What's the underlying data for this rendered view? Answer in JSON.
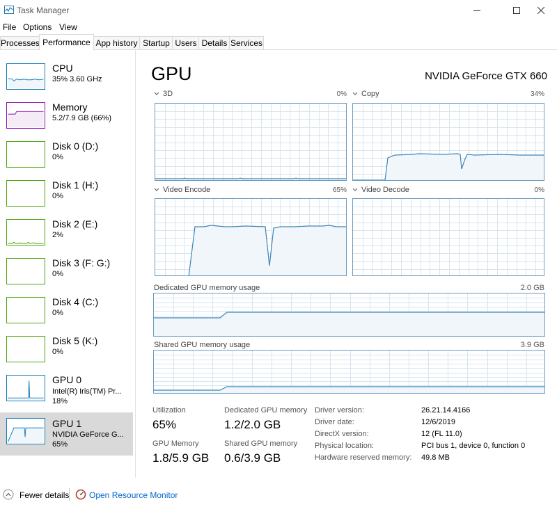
{
  "window": {
    "title": "Task Manager"
  },
  "menu": [
    "File",
    "Options",
    "View"
  ],
  "tabs": [
    "Processes",
    "Performance",
    "App history",
    "Startup",
    "Users",
    "Details",
    "Services"
  ],
  "sidebar": [
    {
      "name": "CPU",
      "line1": "35% 3.60 GHz",
      "line2": "",
      "color": "#117dbb"
    },
    {
      "name": "Memory",
      "line1": "5.2/7.9 GB (66%)",
      "line2": "",
      "color": "#8b12ae"
    },
    {
      "name": "Disk 0 (D:)",
      "line1": "0%",
      "line2": "",
      "color": "#4da60c"
    },
    {
      "name": "Disk 1 (H:)",
      "line1": "0%",
      "line2": "",
      "color": "#4da60c"
    },
    {
      "name": "Disk 2 (E:)",
      "line1": "2%",
      "line2": "",
      "color": "#4da60c"
    },
    {
      "name": "Disk 3 (F: G:)",
      "line1": "0%",
      "line2": "",
      "color": "#4da60c"
    },
    {
      "name": "Disk 4 (C:)",
      "line1": "0%",
      "line2": "",
      "color": "#4da60c"
    },
    {
      "name": "Disk 5 (K:)",
      "line1": "0%",
      "line2": "",
      "color": "#4da60c"
    },
    {
      "name": "GPU 0",
      "line1": "Intel(R) Iris(TM) Pr...",
      "line2": "18%",
      "color": "#117dbb"
    },
    {
      "name": "GPU 1",
      "line1": "NVIDIA GeForce G...",
      "line2": "65%",
      "color": "#117dbb"
    }
  ],
  "gpu": {
    "title": "GPU",
    "model": "NVIDIA GeForce GTX 660",
    "engines": [
      {
        "label": "3D",
        "value": "0%"
      },
      {
        "label": "Copy",
        "value": "34%"
      },
      {
        "label": "Video Encode",
        "value": "65%"
      },
      {
        "label": "Video Decode",
        "value": "0%"
      }
    ],
    "dedicated": {
      "label": "Dedicated GPU memory usage",
      "value": "2.0 GB"
    },
    "shared": {
      "label": "Shared GPU memory usage",
      "value": "3.9 GB"
    },
    "stats": [
      {
        "label": "Utilization",
        "value": "65%"
      },
      {
        "label": "Dedicated GPU memory",
        "value": "1.2/2.0 GB"
      },
      {
        "label": "GPU Memory",
        "value": "1.8/5.9 GB"
      },
      {
        "label": "Shared GPU memory",
        "value": "0.6/3.9 GB"
      }
    ],
    "info": [
      {
        "key": "Driver version:",
        "value": "26.21.14.4166"
      },
      {
        "key": "Driver date:",
        "value": "12/6/2019"
      },
      {
        "key": "DirectX version:",
        "value": "12 (FL 11.0)"
      },
      {
        "key": "Physical location:",
        "value": "PCI bus 1, device 0, function 0"
      },
      {
        "key": "Hardware reserved memory:",
        "value": "49.8 MB"
      }
    ]
  },
  "footer": {
    "fewer_details": "Fewer details",
    "resource_monitor": "Open Resource Monitor"
  },
  "colors": {
    "gpu_line": "#3b86b8",
    "gpu_fill": "#f1f6fa",
    "grid": "#d6e5ef",
    "border": "#6c9bbf"
  }
}
